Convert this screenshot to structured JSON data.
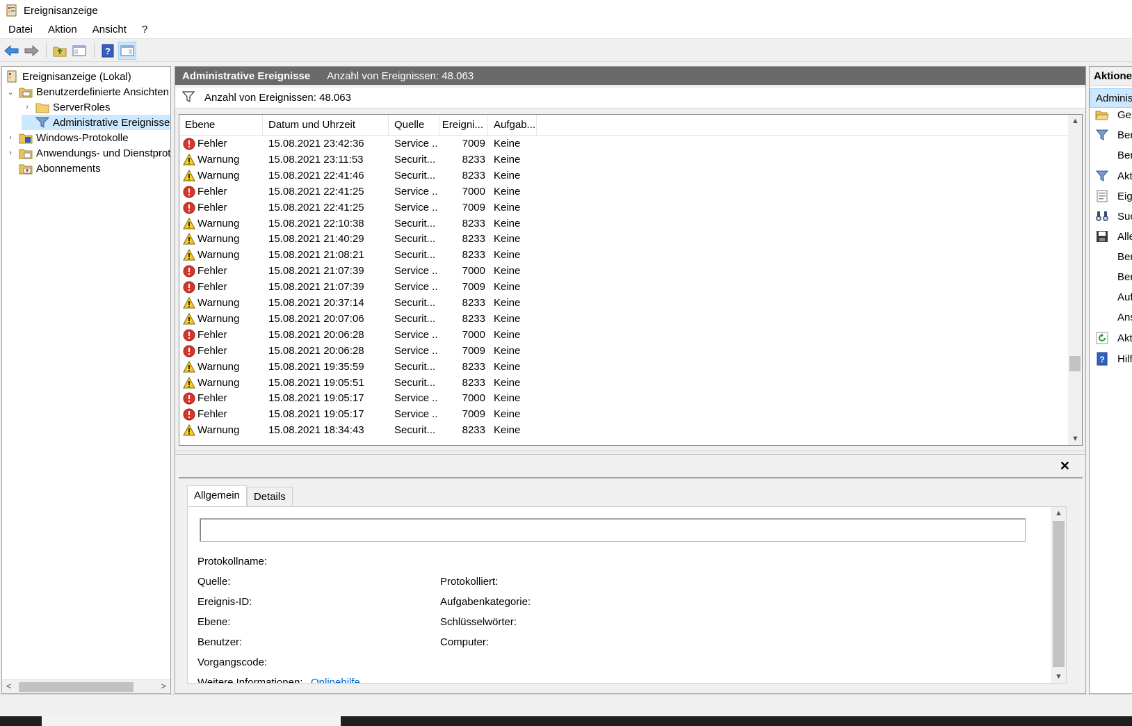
{
  "window": {
    "title": "Ereignisanzeige",
    "icon": "event-viewer-icon"
  },
  "menu": [
    "Datei",
    "Aktion",
    "Ansicht",
    "?"
  ],
  "toolbar": {
    "icons": [
      "back-arrow-icon",
      "forward-arrow-icon",
      "folder-up-icon",
      "show-hide-tree-icon",
      "help-icon",
      "show-hide-action-icon"
    ]
  },
  "tree": {
    "items": [
      {
        "label": "Ereignisanzeige (Lokal)",
        "icon": "event-viewer-icon",
        "level": 0,
        "twisty": ""
      },
      {
        "label": "Benutzerdefinierte Ansichten",
        "icon": "folder-views-icon",
        "level": 1,
        "twisty": "expanded"
      },
      {
        "label": "ServerRoles",
        "icon": "folder-icon",
        "level": 2,
        "twisty": "collapsed"
      },
      {
        "label": "Administrative Ereignisse",
        "icon": "filter-icon",
        "level": 2,
        "twisty": "",
        "selected": true
      },
      {
        "label": "Windows-Protokolle",
        "icon": "windows-logs-icon",
        "level": 1,
        "twisty": "collapsed"
      },
      {
        "label": "Anwendungs- und Dienstprotokolle",
        "icon": "folder-logs-icon",
        "level": 1,
        "twisty": "collapsed"
      },
      {
        "label": "Abonnements",
        "icon": "subscriptions-icon",
        "level": 1,
        "twisty": ""
      }
    ]
  },
  "center": {
    "header_title": "Administrative Ereignisse",
    "header_count": "Anzahl von Ereignissen: 48.063",
    "filter_text": "Anzahl von Ereignissen: 48.063",
    "columns": [
      "Ebene",
      "Datum und Uhrzeit",
      "Quelle",
      "Ereigni...",
      "Aufgab..."
    ],
    "rows": [
      {
        "level": "Fehler",
        "date": "15.08.2021 23:42:36",
        "source": "Service ...",
        "id": "7009",
        "task": "Keine"
      },
      {
        "level": "Warnung",
        "date": "15.08.2021 23:11:53",
        "source": "Securit...",
        "id": "8233",
        "task": "Keine"
      },
      {
        "level": "Warnung",
        "date": "15.08.2021 22:41:46",
        "source": "Securit...",
        "id": "8233",
        "task": "Keine"
      },
      {
        "level": "Fehler",
        "date": "15.08.2021 22:41:25",
        "source": "Service ...",
        "id": "7000",
        "task": "Keine"
      },
      {
        "level": "Fehler",
        "date": "15.08.2021 22:41:25",
        "source": "Service ...",
        "id": "7009",
        "task": "Keine"
      },
      {
        "level": "Warnung",
        "date": "15.08.2021 22:10:38",
        "source": "Securit...",
        "id": "8233",
        "task": "Keine"
      },
      {
        "level": "Warnung",
        "date": "15.08.2021 21:40:29",
        "source": "Securit...",
        "id": "8233",
        "task": "Keine"
      },
      {
        "level": "Warnung",
        "date": "15.08.2021 21:08:21",
        "source": "Securit...",
        "id": "8233",
        "task": "Keine"
      },
      {
        "level": "Fehler",
        "date": "15.08.2021 21:07:39",
        "source": "Service ...",
        "id": "7000",
        "task": "Keine"
      },
      {
        "level": "Fehler",
        "date": "15.08.2021 21:07:39",
        "source": "Service ...",
        "id": "7009",
        "task": "Keine"
      },
      {
        "level": "Warnung",
        "date": "15.08.2021 20:37:14",
        "source": "Securit...",
        "id": "8233",
        "task": "Keine"
      },
      {
        "level": "Warnung",
        "date": "15.08.2021 20:07:06",
        "source": "Securit...",
        "id": "8233",
        "task": "Keine"
      },
      {
        "level": "Fehler",
        "date": "15.08.2021 20:06:28",
        "source": "Service ...",
        "id": "7000",
        "task": "Keine"
      },
      {
        "level": "Fehler",
        "date": "15.08.2021 20:06:28",
        "source": "Service ...",
        "id": "7009",
        "task": "Keine"
      },
      {
        "level": "Warnung",
        "date": "15.08.2021 19:35:59",
        "source": "Securit...",
        "id": "8233",
        "task": "Keine"
      },
      {
        "level": "Warnung",
        "date": "15.08.2021 19:05:51",
        "source": "Securit...",
        "id": "8233",
        "task": "Keine"
      },
      {
        "level": "Fehler",
        "date": "15.08.2021 19:05:17",
        "source": "Service ...",
        "id": "7000",
        "task": "Keine"
      },
      {
        "level": "Fehler",
        "date": "15.08.2021 19:05:17",
        "source": "Service ...",
        "id": "7009",
        "task": "Keine"
      },
      {
        "level": "Warnung",
        "date": "15.08.2021 18:34:43",
        "source": "Securit...",
        "id": "8233",
        "task": "Keine"
      }
    ]
  },
  "detail": {
    "close": "✕",
    "tabs": [
      "Allgemein",
      "Details"
    ],
    "message": "",
    "fields_left": [
      "Protokollname:",
      "Quelle:",
      "Ereignis-ID:",
      "Ebene:",
      "Benutzer:",
      "Vorgangscode:",
      "Weitere Informationen:"
    ],
    "fields_right": [
      "Protokolliert:",
      "Aufgabenkategorie:",
      "Schlüsselwörter:",
      "Computer:"
    ],
    "link": "Onlinehilfe"
  },
  "actions": {
    "header": "Aktionen",
    "sub": "Adminis",
    "items": [
      {
        "label": "Ges",
        "icon": "open-folder-icon"
      },
      {
        "label": "Ber",
        "icon": "filter-icon"
      },
      {
        "label": "Ber",
        "icon": ""
      },
      {
        "label": "Akt",
        "icon": "filter-icon"
      },
      {
        "label": "Eige",
        "icon": "properties-icon"
      },
      {
        "label": "Suc",
        "icon": "binoculars-icon"
      },
      {
        "label": "Alle",
        "icon": "save-icon"
      },
      {
        "label": "Ber",
        "icon": ""
      },
      {
        "label": "Ber",
        "icon": ""
      },
      {
        "label": "Auf",
        "icon": ""
      },
      {
        "label": "Ans",
        "icon": ""
      },
      {
        "label": "Akt",
        "icon": "refresh-icon"
      },
      {
        "label": "Hilf",
        "icon": "help-icon"
      }
    ]
  }
}
